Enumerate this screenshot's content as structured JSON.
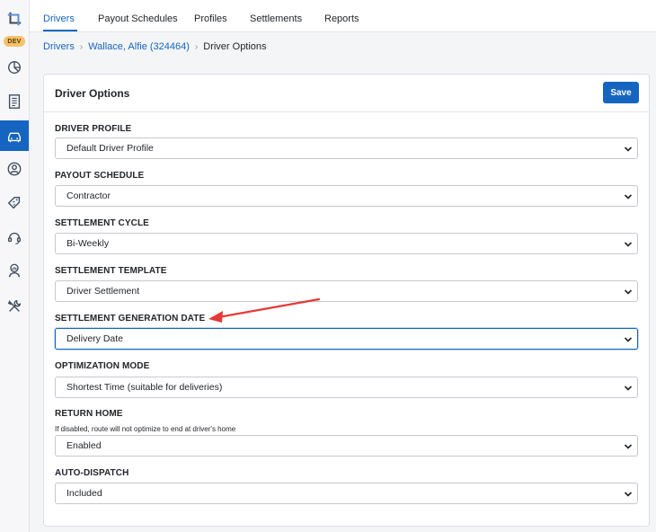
{
  "app": {
    "env_badge": "DEV",
    "colors": {
      "accent": "#1565c0",
      "annotation": "#e53935"
    }
  },
  "rail": {
    "items": [
      {
        "icon": "logo-icon"
      },
      {
        "icon": "chart-pie-icon"
      },
      {
        "icon": "receipt-icon"
      },
      {
        "icon": "car-icon",
        "active": true
      },
      {
        "icon": "user-circle-icon"
      },
      {
        "icon": "tag-dollar-icon"
      },
      {
        "icon": "headset-icon"
      },
      {
        "icon": "analytics-person-icon"
      },
      {
        "icon": "tools-icon"
      }
    ]
  },
  "tabs": [
    {
      "label": "Drivers",
      "active": true
    },
    {
      "label": "Payout Schedules"
    },
    {
      "label": "Profiles"
    },
    {
      "label": "Settlements"
    },
    {
      "label": "Reports"
    }
  ],
  "breadcrumb": {
    "root": "Drivers",
    "driver": "Wallace, Alfie (324464)",
    "current": "Driver Options"
  },
  "card": {
    "title": "Driver Options",
    "save_label": "Save"
  },
  "fields": [
    {
      "label": "DRIVER PROFILE",
      "value": "Default Driver Profile"
    },
    {
      "label": "PAYOUT SCHEDULE",
      "value": "Contractor"
    },
    {
      "label": "SETTLEMENT CYCLE",
      "value": "Bi-Weekly"
    },
    {
      "label": "SETTLEMENT TEMPLATE",
      "value": "Driver Settlement"
    },
    {
      "label": "SETTLEMENT GENERATION DATE",
      "value": "Delivery Date",
      "focused": true
    },
    {
      "label": "OPTIMIZATION MODE",
      "value": "Shortest Time (suitable for deliveries)"
    },
    {
      "label": "RETURN HOME",
      "hint": "If disabled, route will not optimize to end at driver's home",
      "value": "Enabled"
    },
    {
      "label": "AUTO-DISPATCH",
      "value": "Included"
    }
  ]
}
